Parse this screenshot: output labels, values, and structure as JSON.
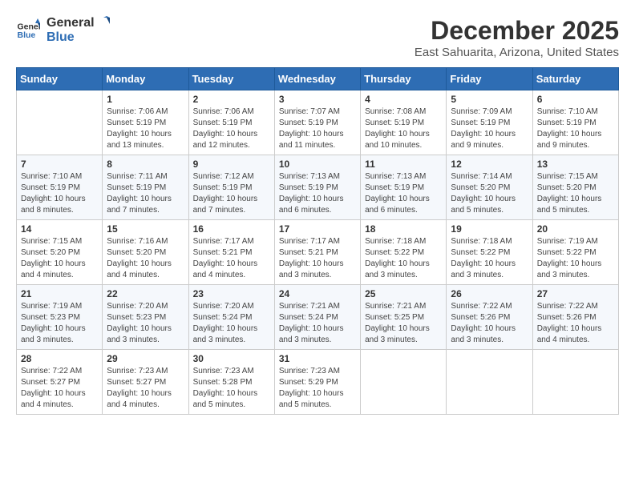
{
  "header": {
    "logo_line1": "General",
    "logo_line2": "Blue",
    "month": "December 2025",
    "location": "East Sahuarita, Arizona, United States"
  },
  "weekdays": [
    "Sunday",
    "Monday",
    "Tuesday",
    "Wednesday",
    "Thursday",
    "Friday",
    "Saturday"
  ],
  "weeks": [
    [
      {
        "day": "",
        "sunrise": "",
        "sunset": "",
        "daylight": ""
      },
      {
        "day": "1",
        "sunrise": "Sunrise: 7:06 AM",
        "sunset": "Sunset: 5:19 PM",
        "daylight": "Daylight: 10 hours and 13 minutes."
      },
      {
        "day": "2",
        "sunrise": "Sunrise: 7:06 AM",
        "sunset": "Sunset: 5:19 PM",
        "daylight": "Daylight: 10 hours and 12 minutes."
      },
      {
        "day": "3",
        "sunrise": "Sunrise: 7:07 AM",
        "sunset": "Sunset: 5:19 PM",
        "daylight": "Daylight: 10 hours and 11 minutes."
      },
      {
        "day": "4",
        "sunrise": "Sunrise: 7:08 AM",
        "sunset": "Sunset: 5:19 PM",
        "daylight": "Daylight: 10 hours and 10 minutes."
      },
      {
        "day": "5",
        "sunrise": "Sunrise: 7:09 AM",
        "sunset": "Sunset: 5:19 PM",
        "daylight": "Daylight: 10 hours and 9 minutes."
      },
      {
        "day": "6",
        "sunrise": "Sunrise: 7:10 AM",
        "sunset": "Sunset: 5:19 PM",
        "daylight": "Daylight: 10 hours and 9 minutes."
      }
    ],
    [
      {
        "day": "7",
        "sunrise": "Sunrise: 7:10 AM",
        "sunset": "Sunset: 5:19 PM",
        "daylight": "Daylight: 10 hours and 8 minutes."
      },
      {
        "day": "8",
        "sunrise": "Sunrise: 7:11 AM",
        "sunset": "Sunset: 5:19 PM",
        "daylight": "Daylight: 10 hours and 7 minutes."
      },
      {
        "day": "9",
        "sunrise": "Sunrise: 7:12 AM",
        "sunset": "Sunset: 5:19 PM",
        "daylight": "Daylight: 10 hours and 7 minutes."
      },
      {
        "day": "10",
        "sunrise": "Sunrise: 7:13 AM",
        "sunset": "Sunset: 5:19 PM",
        "daylight": "Daylight: 10 hours and 6 minutes."
      },
      {
        "day": "11",
        "sunrise": "Sunrise: 7:13 AM",
        "sunset": "Sunset: 5:19 PM",
        "daylight": "Daylight: 10 hours and 6 minutes."
      },
      {
        "day": "12",
        "sunrise": "Sunrise: 7:14 AM",
        "sunset": "Sunset: 5:20 PM",
        "daylight": "Daylight: 10 hours and 5 minutes."
      },
      {
        "day": "13",
        "sunrise": "Sunrise: 7:15 AM",
        "sunset": "Sunset: 5:20 PM",
        "daylight": "Daylight: 10 hours and 5 minutes."
      }
    ],
    [
      {
        "day": "14",
        "sunrise": "Sunrise: 7:15 AM",
        "sunset": "Sunset: 5:20 PM",
        "daylight": "Daylight: 10 hours and 4 minutes."
      },
      {
        "day": "15",
        "sunrise": "Sunrise: 7:16 AM",
        "sunset": "Sunset: 5:20 PM",
        "daylight": "Daylight: 10 hours and 4 minutes."
      },
      {
        "day": "16",
        "sunrise": "Sunrise: 7:17 AM",
        "sunset": "Sunset: 5:21 PM",
        "daylight": "Daylight: 10 hours and 4 minutes."
      },
      {
        "day": "17",
        "sunrise": "Sunrise: 7:17 AM",
        "sunset": "Sunset: 5:21 PM",
        "daylight": "Daylight: 10 hours and 3 minutes."
      },
      {
        "day": "18",
        "sunrise": "Sunrise: 7:18 AM",
        "sunset": "Sunset: 5:22 PM",
        "daylight": "Daylight: 10 hours and 3 minutes."
      },
      {
        "day": "19",
        "sunrise": "Sunrise: 7:18 AM",
        "sunset": "Sunset: 5:22 PM",
        "daylight": "Daylight: 10 hours and 3 minutes."
      },
      {
        "day": "20",
        "sunrise": "Sunrise: 7:19 AM",
        "sunset": "Sunset: 5:22 PM",
        "daylight": "Daylight: 10 hours and 3 minutes."
      }
    ],
    [
      {
        "day": "21",
        "sunrise": "Sunrise: 7:19 AM",
        "sunset": "Sunset: 5:23 PM",
        "daylight": "Daylight: 10 hours and 3 minutes."
      },
      {
        "day": "22",
        "sunrise": "Sunrise: 7:20 AM",
        "sunset": "Sunset: 5:23 PM",
        "daylight": "Daylight: 10 hours and 3 minutes."
      },
      {
        "day": "23",
        "sunrise": "Sunrise: 7:20 AM",
        "sunset": "Sunset: 5:24 PM",
        "daylight": "Daylight: 10 hours and 3 minutes."
      },
      {
        "day": "24",
        "sunrise": "Sunrise: 7:21 AM",
        "sunset": "Sunset: 5:24 PM",
        "daylight": "Daylight: 10 hours and 3 minutes."
      },
      {
        "day": "25",
        "sunrise": "Sunrise: 7:21 AM",
        "sunset": "Sunset: 5:25 PM",
        "daylight": "Daylight: 10 hours and 3 minutes."
      },
      {
        "day": "26",
        "sunrise": "Sunrise: 7:22 AM",
        "sunset": "Sunset: 5:26 PM",
        "daylight": "Daylight: 10 hours and 3 minutes."
      },
      {
        "day": "27",
        "sunrise": "Sunrise: 7:22 AM",
        "sunset": "Sunset: 5:26 PM",
        "daylight": "Daylight: 10 hours and 4 minutes."
      }
    ],
    [
      {
        "day": "28",
        "sunrise": "Sunrise: 7:22 AM",
        "sunset": "Sunset: 5:27 PM",
        "daylight": "Daylight: 10 hours and 4 minutes."
      },
      {
        "day": "29",
        "sunrise": "Sunrise: 7:23 AM",
        "sunset": "Sunset: 5:27 PM",
        "daylight": "Daylight: 10 hours and 4 minutes."
      },
      {
        "day": "30",
        "sunrise": "Sunrise: 7:23 AM",
        "sunset": "Sunset: 5:28 PM",
        "daylight": "Daylight: 10 hours and 5 minutes."
      },
      {
        "day": "31",
        "sunrise": "Sunrise: 7:23 AM",
        "sunset": "Sunset: 5:29 PM",
        "daylight": "Daylight: 10 hours and 5 minutes."
      },
      {
        "day": "",
        "sunrise": "",
        "sunset": "",
        "daylight": ""
      },
      {
        "day": "",
        "sunrise": "",
        "sunset": "",
        "daylight": ""
      },
      {
        "day": "",
        "sunrise": "",
        "sunset": "",
        "daylight": ""
      }
    ]
  ]
}
